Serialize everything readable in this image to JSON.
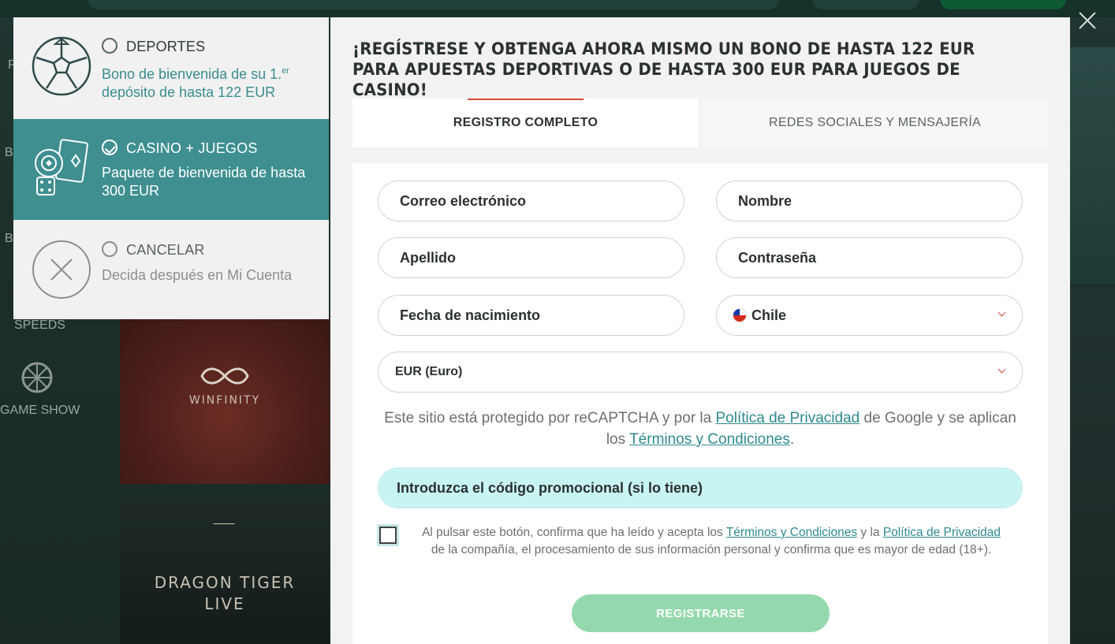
{
  "background": {
    "sidebar": [
      "SPEEDS",
      "GAME SHOW"
    ],
    "sidebar_partial": [
      "P",
      "B",
      "B"
    ],
    "tiles": {
      "winfinity": "WINFINITY",
      "dragon_tiger": "DRAGON TIGER LIVE"
    }
  },
  "close_icon": "close-icon",
  "bonus_options": {
    "sport": {
      "title": "DEPORTES",
      "desc_pre": "Bono de bienvenida de su 1.",
      "desc_sup": "er",
      "desc_post": "depósito de hasta 122 EUR",
      "icon": "soccer-ball-icon",
      "selected": false
    },
    "casino": {
      "title": "CASINO + JUEGOS",
      "desc": "Paquete de bienvenida de hasta 300 EUR",
      "icon": "casino-chips-cards-dice-icon",
      "selected": true
    },
    "cancel": {
      "title": "CANCELAR",
      "desc": "Decida después en Mi Cuenta",
      "icon": "cancel-circle-icon",
      "selected": false
    }
  },
  "modal": {
    "title": "¡REGÍSTRESE Y OBTENGA AHORA MISMO UN BONO DE HASTA 122 EUR PARA APUESTAS DEPORTIVAS O DE HASTA 300 EUR PARA JUEGOS DE CASINO!",
    "tabs": [
      {
        "label": "REGISTRO COMPLETO",
        "active": true
      },
      {
        "label": "REDES SOCIALES Y MENSAJERÍA",
        "active": false
      }
    ],
    "fields": {
      "email": "Correo electrónico",
      "first_name": "Nombre",
      "last_name": "Apellido",
      "password": "Contraseña",
      "birth_date": "Fecha de nacimiento",
      "country": "Chile",
      "currency": "EUR (Euro)"
    },
    "recaptcha": {
      "part1": "Este sitio está protegido por reCAPTCHA y por la ",
      "privacy_link": "Política de Privacidad",
      "part2": " de Google y se aplican los ",
      "terms_link": "Términos y Condiciones",
      "part3": "."
    },
    "promo": "Introduzca el código promocional (si lo tiene)",
    "consent": {
      "part1": "Al pulsar este botón, confirma que ha leído y acepta los ",
      "terms_link": "Términos y Condiciones",
      "part2": " y la ",
      "privacy_link": "Política de Privacidad",
      "part3": " de la compañía, el procesamiento de sus información personal y confirma que es mayor de edad (18+).",
      "checked": false
    },
    "register_button": "REGISTRARSE"
  },
  "colors": {
    "accent_teal": "#3f8f90",
    "link_teal": "#2d8a8f",
    "tab_underline": "#d94a38",
    "promo_bg": "#c8f5f4",
    "register_btn": "#94d9ad"
  }
}
